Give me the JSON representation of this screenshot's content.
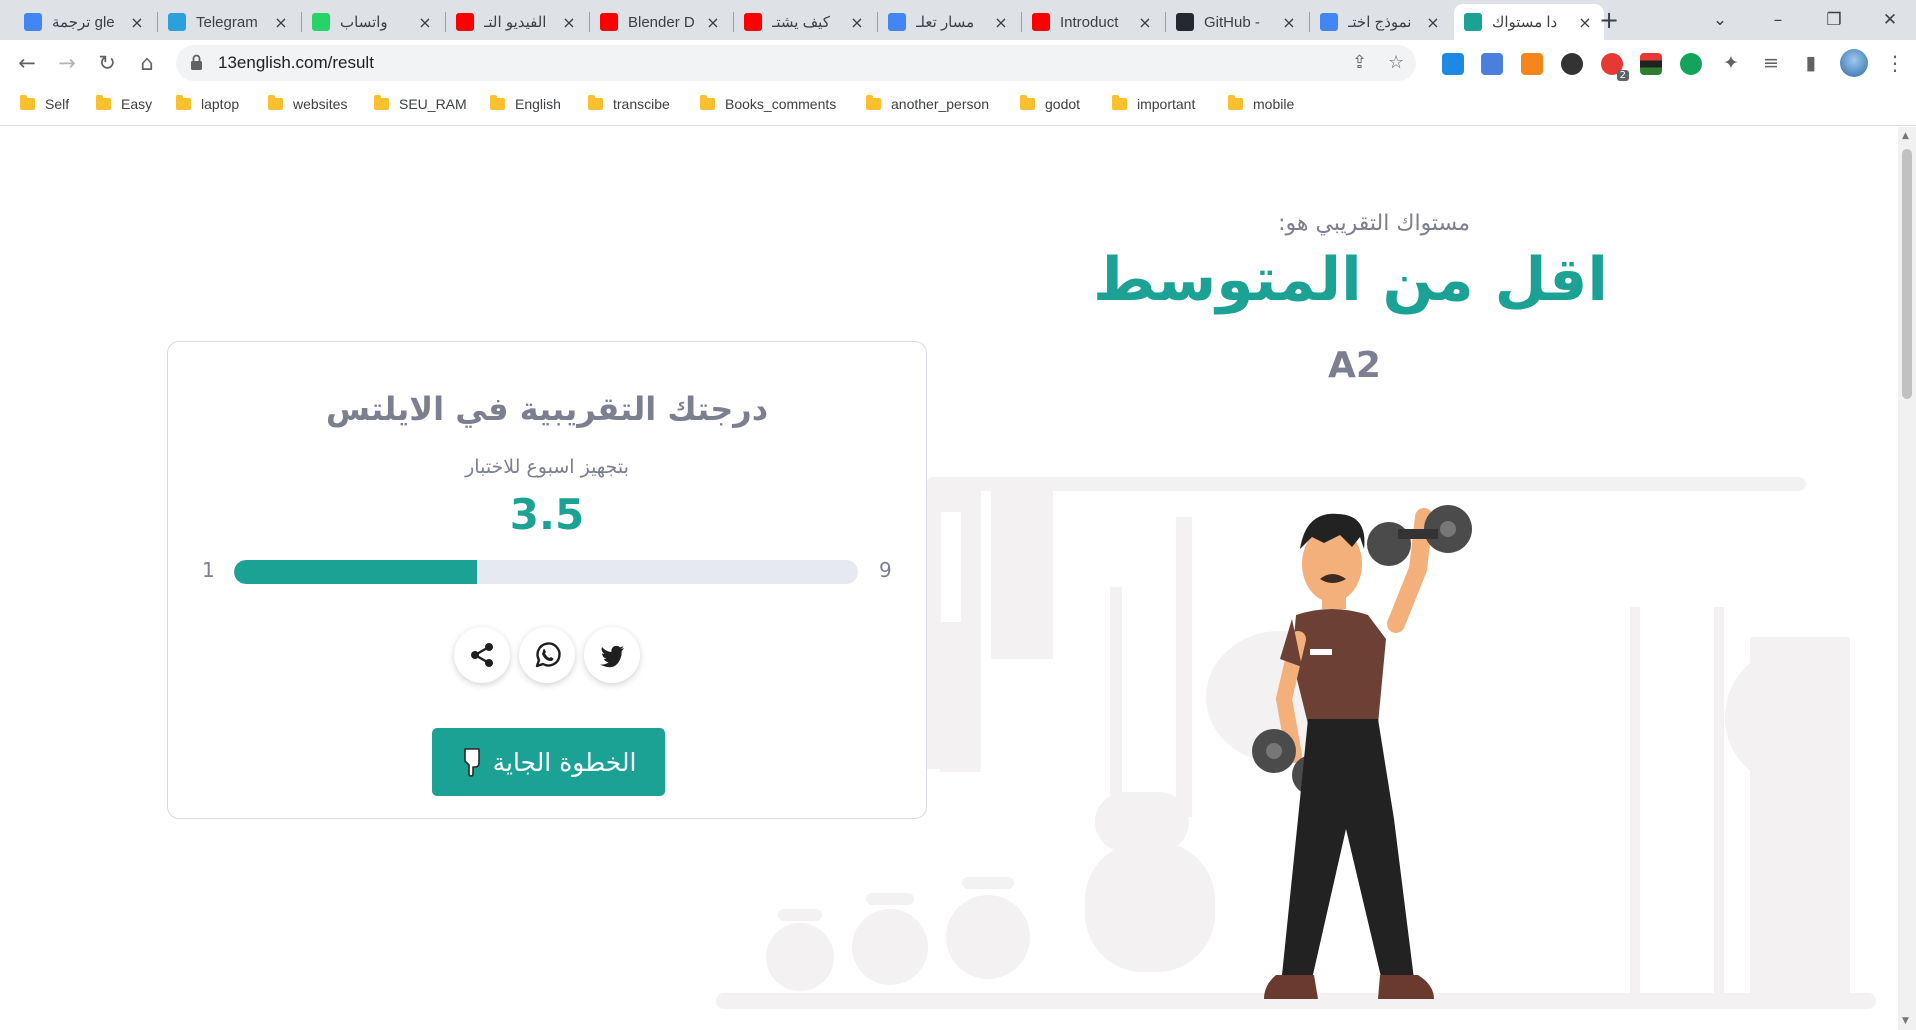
{
  "browser": {
    "tabs": [
      {
        "title": "ترجمة gle",
        "icon": "google-translate-icon",
        "color": "#4285f4"
      },
      {
        "title": "Telegram",
        "icon": "telegram-icon",
        "color": "#2aa1da"
      },
      {
        "title": "واتساب",
        "icon": "whatsapp-icon",
        "color": "#25d366"
      },
      {
        "title": "الفيديو التـ",
        "icon": "youtube-icon",
        "color": "#ff0000"
      },
      {
        "title": "Blender D",
        "icon": "youtube-icon",
        "color": "#ff0000"
      },
      {
        "title": "كيف يشتـ",
        "icon": "youtube-icon",
        "color": "#ff0000"
      },
      {
        "title": "مسار تعلـ",
        "icon": "google-icon",
        "color": "#4285f4"
      },
      {
        "title": "Introduct",
        "icon": "youtube-icon",
        "color": "#ff0000"
      },
      {
        "title": "GitHub -",
        "icon": "github-icon",
        "color": "#24292f"
      },
      {
        "title": "نموذج اختـ",
        "icon": "google-icon",
        "color": "#4285f4"
      },
      {
        "title": "دا مستواك",
        "icon": "site-icon",
        "color": "#1ba294",
        "active": true
      }
    ],
    "url": "13english.com/result",
    "bookmarks": [
      "Self",
      "Easy",
      "laptop",
      "websites",
      "SEU_RAM",
      "English",
      "transcibe",
      "Books_comments",
      "another_person",
      "godot",
      "important",
      "mobile"
    ],
    "extension_badge": "2"
  },
  "result": {
    "level_label": "مستواك التقريبي هو:",
    "level_name": "اقل من المتوسط",
    "level_code": "A2"
  },
  "card": {
    "title": "درجتك التقريبية في الايلتس",
    "subtitle": "بتجهيز اسبوع للاختبار",
    "score": "3.5",
    "scale_min": "1",
    "scale_max": "9",
    "progress_fraction": 0.39,
    "next_label": "الخطوة الجاية",
    "next_icon": "hand-pointing-down-icon"
  },
  "colors": {
    "accent": "#1ba294",
    "muted_text": "#7c7f90",
    "track": "#e6e9ef"
  }
}
